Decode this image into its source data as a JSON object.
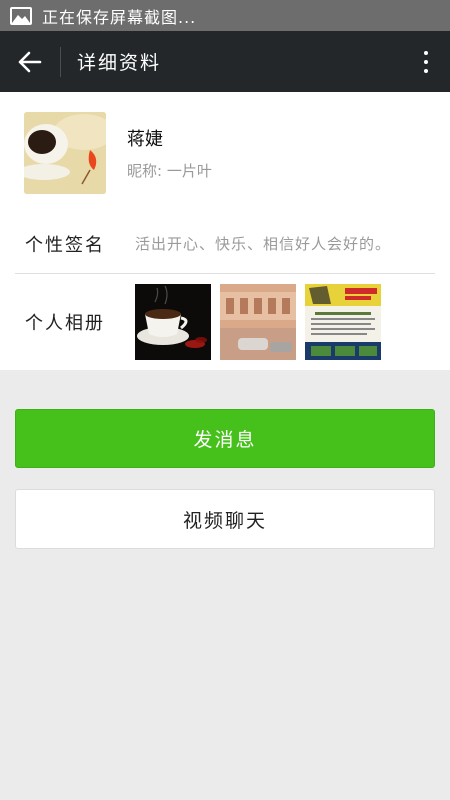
{
  "status_bar": {
    "text": "正在保存屏幕截图..."
  },
  "header": {
    "title": "详细资料"
  },
  "profile": {
    "name": "蒋婕",
    "nickname": "昵称: 一片叶"
  },
  "info": {
    "signature_label": "个性签名",
    "signature_value": "活出开心、快乐、相信好人会好的。",
    "album_label": "个人相册"
  },
  "actions": {
    "send_message": "发消息",
    "video_chat": "视频聊天"
  },
  "colors": {
    "header_bg": "#23272a",
    "accent_green": "#46c01b",
    "status_bar_bg": "#6d6d6d"
  },
  "icons": {
    "back": "arrow-left-icon",
    "more": "more-vertical-icon",
    "status": "image-icon"
  }
}
